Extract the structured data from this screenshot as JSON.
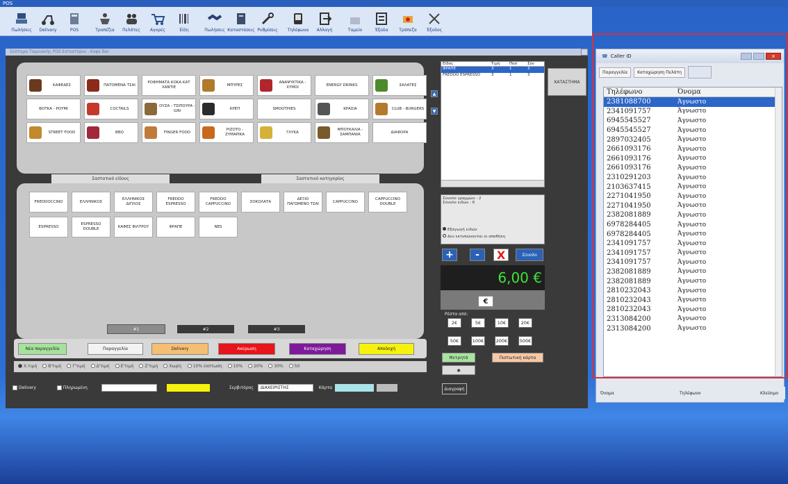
{
  "window_title": "POS",
  "toolbar": [
    {
      "label": "Πωλήσεις",
      "icon": "cashier-icon"
    },
    {
      "label": "Delivery",
      "icon": "scooter-icon"
    },
    {
      "label": "POS",
      "icon": "calculator-icon"
    },
    {
      "label": "Τραπέζια",
      "icon": "waiter-icon"
    },
    {
      "label": "Πελάτες",
      "icon": "customers-icon"
    },
    {
      "label": "Αγορές",
      "icon": "cart-icon"
    },
    {
      "label": "Είδη",
      "icon": "barcode-icon"
    },
    {
      "label": "Πωλήσεις",
      "icon": "handshake-icon"
    },
    {
      "label": "Καταστάσεις",
      "icon": "report-icon"
    },
    {
      "label": "Ρυθμίσεις",
      "icon": "wrench-icon"
    },
    {
      "label": "Τηλέφωνα",
      "icon": "phone-icon"
    },
    {
      "label": "Αλλαγή",
      "icon": "exit-icon"
    },
    {
      "label": "Ταμείο",
      "icon": "register-icon"
    },
    {
      "label": "Έξοδα",
      "icon": "list-icon"
    },
    {
      "label": "Τράπεζα",
      "icon": "money-icon"
    },
    {
      "label": "Έξοδος",
      "icon": "close-icon"
    }
  ],
  "subtitle": "Σύστημα Ταμειακής POS Εστιατόρια - Καφέ Bar",
  "categories": [
    {
      "label": "ΚΑΦΕΔΕΣ",
      "icon": "coffee-icon",
      "color": "#6b3a1e"
    },
    {
      "label": "ΠΑΤΟΜΕΝΑ ΤΣΑΙ",
      "icon": "tea-icon",
      "color": "#8a2b1b"
    },
    {
      "label": "ΡΟΦΗΜΑΤΑ ΚΟΚΑ ΚΑΤ ΧΑΝΤΙΕ",
      "icon": "",
      "color": ""
    },
    {
      "label": "ΜΠΥΡΕΣ",
      "icon": "beer-icon",
      "color": "#b07a2a"
    },
    {
      "label": "ΑΝΑΨΥΚΤΙΚΑ - ΧΥΜΟΙ",
      "icon": "soda-icon",
      "color": "#b1252b"
    },
    {
      "label": "ENERGY DRINKS",
      "icon": "",
      "color": ""
    },
    {
      "label": "ΣΑΛΑΤΕΣ",
      "icon": "salad-icon",
      "color": "#4d8a2c"
    },
    {
      "label": "ΒΟΤΚΑ - ΡΟΥΜΙ",
      "icon": "",
      "color": ""
    },
    {
      "label": "COCTAILS",
      "icon": "cocktail-icon",
      "color": "#c4392a"
    },
    {
      "label": "ΟΥΖΑ - ΤΣΙΠΟΥΡΑ - GIN",
      "icon": "ouzo-icon",
      "color": "#8b6a3a"
    },
    {
      "label": "ΚΡΕΠ",
      "icon": "wine-icon",
      "color": "#2b2b2b"
    },
    {
      "label": "SMOOTHIES",
      "icon": "",
      "color": ""
    },
    {
      "label": "ΚΡΑΣΙΑ",
      "icon": "bottle-icon",
      "color": "#555"
    },
    {
      "label": "CLUB - BURGERS",
      "icon": "burger-icon",
      "color": "#b5792e"
    },
    {
      "label": "STREET FOOD",
      "icon": "streetfood-icon",
      "color": "#c28a2c"
    },
    {
      "label": "BBQ",
      "icon": "bbq-icon",
      "color": "#a0283a"
    },
    {
      "label": "FINGER FOOD",
      "icon": "finger-icon",
      "color": "#c07a3a"
    },
    {
      "label": "ΡΙΖΟΤΟ - ΖΥΜΑΡΙΚΑ",
      "icon": "risotto-icon",
      "color": "#c86a1c"
    },
    {
      "label": "ΓΛΥΚΑ",
      "icon": "dessert-icon",
      "color": "#d6b13a"
    },
    {
      "label": "ΜΠΟΥΚΑΛΙΑ - ΣΑΜΠΑΝΙΑ",
      "icon": "champagne-icon",
      "color": "#7a5a2a"
    },
    {
      "label": "ΔΙΑΦΟΡΑ",
      "icon": "",
      "color": ""
    }
  ],
  "section_labels": {
    "items": "Σαστατικό είδους",
    "category": "Σαστατικό κατηγορίας"
  },
  "products": [
    "FREDDOCCINO",
    "ΕΛΛΗΝΙΚΟΣ",
    "ΕΛΛΗΝΙΚΟΣ ΔΙΠΛΟΣ",
    "FREDDO ESPRESSO",
    "FREDDO CAPPUCCINO",
    "ΣΟΚΟΛΑΤΑ",
    "ΔΕΞΙΟ ΠΑΓΩΜΕΝΟ ΤΣΑΙ",
    "CAPPUCCINO",
    "CAPPUCCINO DOUBLE",
    "ESPRESSO",
    "ESPRESSO DOUBLE",
    "ΚΑΦΕΣ ΦΙΛΤΡΟΥ",
    "ΦΡΑΠΕ",
    "NES"
  ],
  "pages": [
    "#1",
    "#2",
    "#3"
  ],
  "order": {
    "headers": [
      "Είδος",
      "Τιμή",
      "Ποσ",
      "Σύν"
    ],
    "rows": [
      [
        "ΦΡΑΠΕ",
        "3",
        "1",
        "3"
      ],
      [
        "FREDDO ESPRESSO",
        "3",
        "1",
        "3"
      ]
    ],
    "summary_lines": [
      "Σύνολο γραμμών : 2",
      "Σύνολο ειδών : 6"
    ],
    "radio1": "Εξαγωγή ειδών",
    "radio2": "Δεν εκτυπώνονται οι αποθήκη",
    "total": "6,00 €",
    "currency_symbol": "€",
    "payment_label": "Ρέστα από:",
    "cash_row1": [
      "2€",
      "5€",
      "10€",
      "20€"
    ],
    "cash_row2": [
      "50€",
      "100€",
      "200€",
      "500€"
    ],
    "cash_btn": "Μετρητά",
    "card_btn": "Πιστωτική κάρτα",
    "extra_btn": "Διαγραφή",
    "settle_btn": "Σύνολο",
    "category_btn": "ΚΑΤΑΣΤΗΜΑ"
  },
  "bottom": {
    "new_order": "Νέα παραγγελία",
    "order": "Παραγγελία",
    "delivery": "Delivery",
    "cancel": "Ακύρωση",
    "save": "Καταχώρηση",
    "exit": "Αποδοχή",
    "discounts": [
      "Χ.τιμή",
      "Β'τιμή",
      "Γ'τιμή",
      "Δ'τιμή",
      "Ε'τιμή",
      "Ζ'τιμή",
      "Χωρίς",
      "10% έκπτωση",
      "10%",
      "20%",
      "30%",
      "50"
    ],
    "chk_delivery": "Delivery",
    "chk_pay": "Πληρωμένη",
    "waiter_label": "Σερβιτόρος",
    "waiter_value": "ΔΙΑΧΕΙΡΙΣΤΗΣ",
    "table_label": "Κάρτα"
  },
  "caller": {
    "title": "Caller ID",
    "tab1": "Παραγγελία",
    "tab2": "Καταχώρηση Πελάτη",
    "col_phone": "Τηλέφωνο",
    "col_name": "Όνομα",
    "rows": [
      [
        "2381088700",
        "Άγνωστο"
      ],
      [
        "2341091757",
        "Άγνωστο"
      ],
      [
        "6945545527",
        "Άγνωστο"
      ],
      [
        "6945545527",
        "Άγνωστο"
      ],
      [
        "2897032405",
        "Άγνωστο"
      ],
      [
        "2661093176",
        "Άγνωστο"
      ],
      [
        "2661093176",
        "Άγνωστο"
      ],
      [
        "2661093176",
        "Άγνωστο"
      ],
      [
        "2310291203",
        "Άγνωστο"
      ],
      [
        "2103637415",
        "Άγνωστο"
      ],
      [
        "2271041950",
        "Άγνωστο"
      ],
      [
        "2271041950",
        "Άγνωστο"
      ],
      [
        "2382081889",
        "Άγνωστο"
      ],
      [
        "6978284405",
        "Άγνωστο"
      ],
      [
        "6978284405",
        "Άγνωστο"
      ],
      [
        "2341091757",
        "Άγνωστο"
      ],
      [
        "2341091757",
        "Άγνωστο"
      ],
      [
        "2341091757",
        "Άγνωστο"
      ],
      [
        "2382081889",
        "Άγνωστο"
      ],
      [
        "2382081889",
        "Άγνωστο"
      ],
      [
        "2810232043",
        "Άγνωστο"
      ],
      [
        "2810232043",
        "Άγνωστο"
      ],
      [
        "2810232043",
        "Άγνωστο"
      ],
      [
        "2313084200",
        "Άγνωστο"
      ],
      [
        "2313084200",
        "Άγνωστο"
      ]
    ],
    "footer": [
      "Όνομα",
      "Τηλέφωνο",
      "Κλείσιμο"
    ]
  }
}
